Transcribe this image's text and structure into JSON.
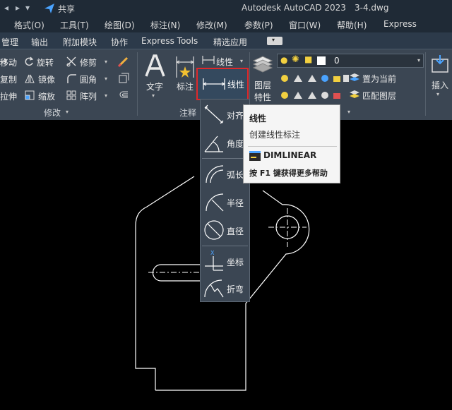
{
  "titlebar": {
    "share": "共享",
    "app_title": "Autodesk AutoCAD 2023",
    "file_name": "3-4.dwg"
  },
  "menubar": {
    "items": [
      "格式(O)",
      "工具(T)",
      "绘图(D)",
      "标注(N)",
      "修改(M)",
      "参数(P)",
      "窗口(W)",
      "帮助(H)",
      "Express"
    ]
  },
  "tabs": {
    "items": [
      "管理",
      "输出",
      "附加模块",
      "协作",
      "Express Tools",
      "精选应用"
    ]
  },
  "ribbon": {
    "modify": {
      "title": "修改",
      "move": "移动",
      "rotate": "旋转",
      "trim": "修剪",
      "copy": "复制",
      "mirror": "镜像",
      "fillet": "圆角",
      "stretch": "拉伸",
      "scale": "缩放",
      "array": "阵列"
    },
    "annotation": {
      "title": "注释",
      "text": "文字",
      "dimension": "标注",
      "linear_top": "线性",
      "linear": "线性"
    },
    "layers": {
      "properties": "图层",
      "properties2": "特性",
      "current_layer": "0",
      "set_current": "置为当前",
      "match_layer": "匹配图层"
    },
    "insert": {
      "label": "插入"
    }
  },
  "dropdown": {
    "items": [
      "对齐",
      "角度",
      "弧长",
      "半径",
      "直径",
      "坐标",
      "折弯"
    ]
  },
  "tooltip": {
    "title": "线性",
    "description": "创建线性标注",
    "command": "DIMLINEAR",
    "help": "按 F1 键获得更多帮助"
  },
  "colors": {
    "titlebar_bg": "#1f2a36",
    "ribbon_bg": "#3b4653",
    "highlight": "#e0282a",
    "canvas_bg": "#000000",
    "drawing_line": "#ffffff",
    "accent_blue": "#4aa3ff"
  }
}
